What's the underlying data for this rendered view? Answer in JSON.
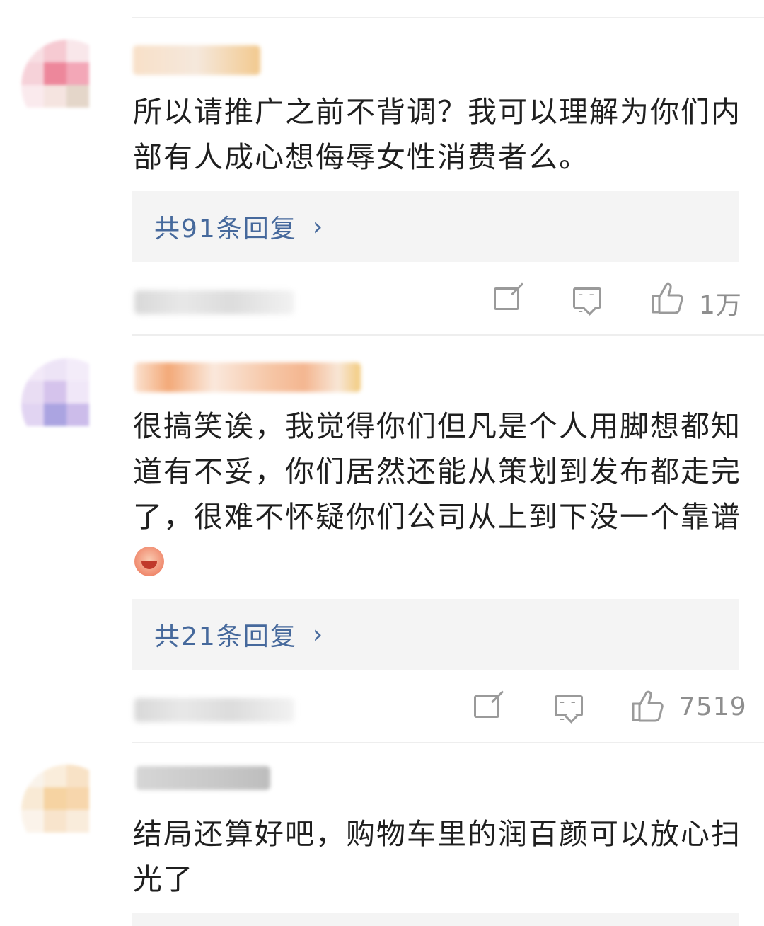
{
  "comments": [
    {
      "text": "所以请推广之前不背调？我可以理解为你们内部有人成心想侮辱女性消费者么。",
      "reply_label": "共91条回复",
      "reply_chevron": "›",
      "like_count": "1万"
    },
    {
      "text": "很搞笑诶，我觉得你们但凡是个人用脚想都知道有不妥，你们居然还能从策划到发布都走完了，很难不怀疑你们公司从上到下没一个靠谱",
      "reply_label": "共21条回复",
      "reply_chevron": "›",
      "like_count": "7519"
    },
    {
      "text": "结局还算好吧，购物车里的润百颜可以放心扫光了"
    }
  ],
  "icons": {
    "edit": "share-edit-icon",
    "comment": "comment-icon",
    "like": "thumbs-up-icon"
  },
  "colors": {
    "reply_link": "#46699c",
    "reply_box": "#f4f4f4",
    "meta_gray": "#8e8e8e"
  }
}
